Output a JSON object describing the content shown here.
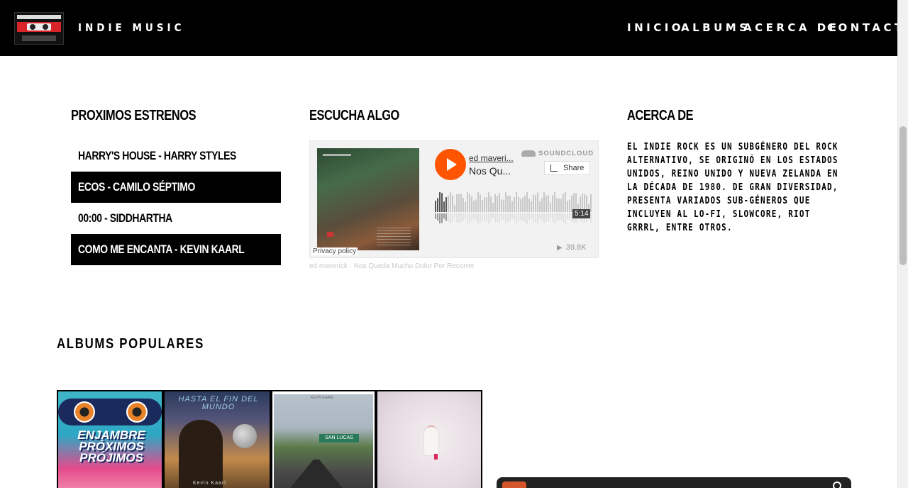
{
  "header": {
    "brand": "INDIE MUSIC",
    "nav": [
      "INICIO",
      "ALBUMS",
      "ACERCA DE",
      "CONTACT"
    ]
  },
  "releases": {
    "title": "PROXIMOS ESTRENOS",
    "items": [
      "HARRY'S HOUSE - HARRY STYLES",
      "ECOS - CAMILO SÉPTIMO",
      "00:00 - SIDDHARTHA",
      "COMO ME ENCANTA - KEVIN KAARL"
    ]
  },
  "listen": {
    "title": "ESCUCHA ALGO",
    "player": {
      "artist": "ed maveri...",
      "track": "Nos Qu...",
      "brand": "SOUNDCLOUD",
      "share_label": "Share",
      "duration": "5:14",
      "plays": "39.8K",
      "privacy": "Privacy policy",
      "accent_color": "#ff5500"
    },
    "caption": "ed maverick · Nos Queda Mucho Dolor Por Recorrer"
  },
  "about": {
    "title": "ACERCA DE",
    "text": "EL INDIE ROCK ES UN SUBGÉNERO DEL ROCK ALTERNATIVO, SE ORIGINÓ EN LOS ESTADOS UNIDOS, REINO UNIDO Y NUEVA ZELANDA EN LA DÉCADA DE 1980. DE GRAN DIVERSIDAD, PRESENTA VARIADOS SUB-GÉNEROS QUE INCLUYEN AL LO-FI, SLOWCORE, RIOT GRRRL, ENTRE OTROS."
  },
  "albums": {
    "title": "ALBUMS POPULARES",
    "covers": [
      {
        "text": "ENJAMBRE PRÓXIMOS PRÓJIMOS"
      },
      {
        "text": "HASTA EL FIN DEL MUNDO",
        "artist": "Kevin Kaarl"
      },
      {
        "text": "SAN LUCAS",
        "artist": "KEVIN KAARL"
      },
      {
        "text": ""
      }
    ]
  }
}
